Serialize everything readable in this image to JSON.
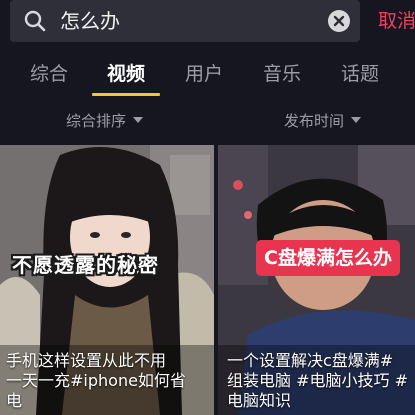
{
  "search": {
    "query": "怎么办",
    "cancel_label": "取消"
  },
  "tabs": [
    {
      "label": "综合",
      "active": false
    },
    {
      "label": "视频",
      "active": true
    },
    {
      "label": "用户",
      "active": false
    },
    {
      "label": "音乐",
      "active": false
    },
    {
      "label": "话题",
      "active": false
    }
  ],
  "filters": {
    "sort_label": "综合排序",
    "time_label": "发布时间"
  },
  "videos": [
    {
      "overlay_text": "不愿透露的秘密",
      "caption_lines": [
        "手机这样设置从此不用",
        "一天一充#iphone如何省",
        "电"
      ]
    },
    {
      "overlay_text": "C盘爆满怎么办",
      "caption_lines": [
        "一个设置解决c盘爆满#",
        "组装电脑 #电脑小技巧 #",
        "电脑知识"
      ]
    }
  ],
  "colors": {
    "accent_red": "#f0405e",
    "tab_underline": "#f5c243",
    "background": "#15161f"
  },
  "icons": {
    "search": "magnifier",
    "clear": "circle-x",
    "filter_caret": "triangle-down"
  }
}
